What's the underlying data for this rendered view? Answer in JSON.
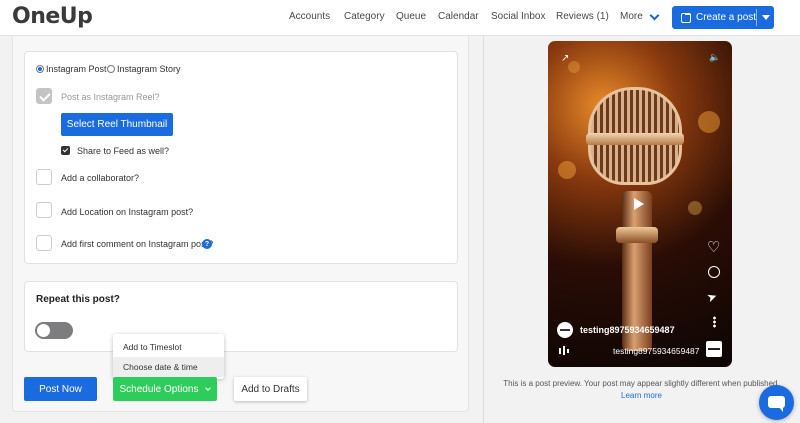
{
  "header": {
    "logo": "OneUp",
    "nav": [
      "Accounts",
      "Category",
      "Queue",
      "Calendar",
      "Social Inbox",
      "Reviews (1)"
    ],
    "more_label": "More",
    "create_label": "Create a post"
  },
  "post_type": {
    "options": [
      "Instagram Post",
      "Instagram Story"
    ],
    "selected": "Instagram Post"
  },
  "options": {
    "reel_label": "Post as Instagram Reel?",
    "reel_checked": true,
    "thumbnail_button": "Select Reel Thumbnail",
    "share_feed_label": "Share to Feed as well?",
    "share_feed_checked": true,
    "collaborator_label": "Add a collaborator?",
    "location_label": "Add Location on Instagram post?",
    "first_comment_label": "Add first comment on Instagram post?",
    "help_glyph": "?"
  },
  "repeat": {
    "title": "Repeat this post?",
    "enabled": false
  },
  "schedule_menu": {
    "items": [
      "Add to Timeslot",
      "Choose date & time"
    ],
    "highlighted": "Choose date & time"
  },
  "actions": {
    "post_now": "Post Now",
    "schedule": "Schedule Options",
    "drafts": "Add to Drafts"
  },
  "preview": {
    "username": "testing8975934659487",
    "audio_username": "testing8975934659487",
    "note": "This is a post preview. Your post may appear slightly different when published.",
    "learn_more": "Learn more"
  },
  "icons": {
    "external": "↗",
    "speaker": "🔈",
    "heart": "♡",
    "send": "➤"
  },
  "colors": {
    "accent": "#1a6ae0",
    "schedule": "#2ecc5b"
  }
}
